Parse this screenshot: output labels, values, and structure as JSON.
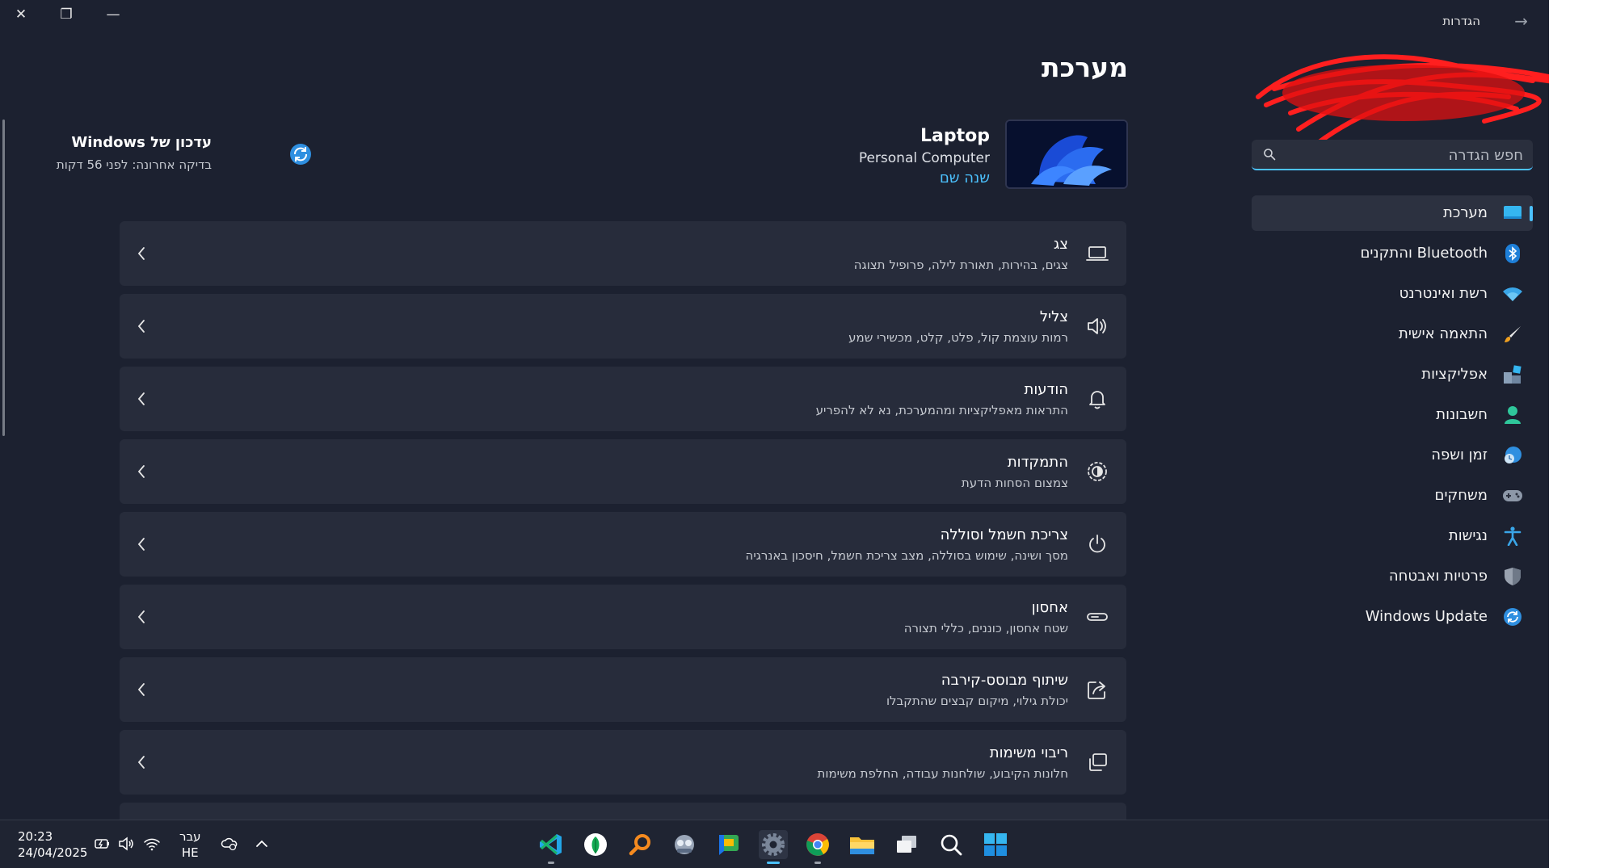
{
  "window": {
    "title": "הגדרות",
    "controls": {
      "close": "✕",
      "restore": "❐",
      "minimize": "—"
    }
  },
  "search": {
    "placeholder": "חפש הגדרה"
  },
  "sidebar": {
    "items": [
      {
        "label": "מערכת",
        "icon": "monitor-icon",
        "active": true
      },
      {
        "label": "Bluetooth והתקנים",
        "icon": "bluetooth-icon"
      },
      {
        "label": "רשת ואינטרנט",
        "icon": "wifi-icon"
      },
      {
        "label": "התאמה אישית",
        "icon": "brush-icon"
      },
      {
        "label": "אפליקציות",
        "icon": "apps-icon"
      },
      {
        "label": "חשבונות",
        "icon": "person-icon"
      },
      {
        "label": "זמן ושפה",
        "icon": "globe-clock-icon"
      },
      {
        "label": "משחקים",
        "icon": "gamepad-icon"
      },
      {
        "label": "נגישות",
        "icon": "accessibility-icon"
      },
      {
        "label": "פרטיות ואבטחה",
        "icon": "shield-icon"
      },
      {
        "label": "Windows Update",
        "icon": "update-icon"
      }
    ]
  },
  "main": {
    "title": "מערכת",
    "device": {
      "name": "Laptop",
      "type": "Personal Computer",
      "rename_label": "שנה שם"
    },
    "update": {
      "title": "עדכון של Windows",
      "subtitle": "בדיקה אחרונה: לפני 56 דקות"
    },
    "settings": [
      {
        "title": "צג",
        "subtitle": "צגים, בהירות, תאורת לילה, פרופיל תצוגה",
        "icon": "display-icon"
      },
      {
        "title": "צליל",
        "subtitle": "רמות עוצמת קול, פלט, קלט, מכשירי שמע",
        "icon": "speaker-icon"
      },
      {
        "title": "הודעות",
        "subtitle": "התראות מאפליקציות ומהמערכת, נא לא להפריע",
        "icon": "bell-icon"
      },
      {
        "title": "התמקדות",
        "subtitle": "צמצום הסחות הדעת",
        "icon": "focus-icon"
      },
      {
        "title": "צריכת חשמל וסוללה",
        "subtitle": "מסך ושינה, שימוש בסוללה, מצב צריכת חשמל, חיסכון באנרגיה",
        "icon": "power-icon"
      },
      {
        "title": "אחסון",
        "subtitle": "שטח אחסון, כוננים, כללי תצורה",
        "icon": "storage-icon"
      },
      {
        "title": "שיתוף מבוסס-קירבה",
        "subtitle": "יכולת גילוי, מיקום קבצים שהתקבלו",
        "icon": "share-icon"
      },
      {
        "title": "ריבוי משימות",
        "subtitle": "חלונות הקיבוע, שולחנות עבודה, החלפת משימות",
        "icon": "multitask-icon"
      }
    ]
  },
  "taskbar": {
    "time": "20:23",
    "date": "24/04/2025",
    "lang_line1": "עבר",
    "lang_line2": "HE",
    "tray_icons": [
      "caret-up-icon",
      "cloud-icon",
      "wifi-icon",
      "speaker-icon",
      "battery-icon"
    ],
    "apps": [
      "start-icon",
      "search-icon",
      "task-view-icon",
      "file-explorer-icon",
      "chrome-icon",
      "settings-icon",
      "chat-app-icon",
      "network-app-icon",
      "magnifier-app-icon",
      "leaf-app-icon",
      "vscode-icon"
    ]
  },
  "colors": {
    "accent": "#4cc2ff",
    "window_bg": "#1c2130",
    "card_bg": "#272c3b"
  }
}
